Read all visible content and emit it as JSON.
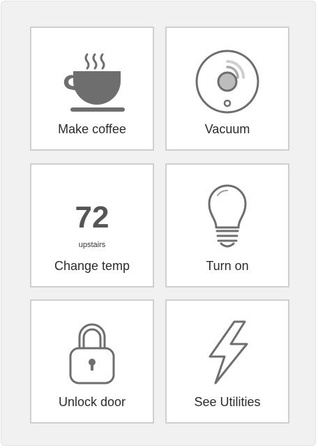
{
  "tiles": [
    {
      "label": "Make coffee",
      "icon": "coffee-cup-icon"
    },
    {
      "label": "Vacuum",
      "icon": "robot-vacuum-icon"
    },
    {
      "label": "Change temp",
      "icon": "thermostat-readout",
      "value": "72",
      "sublabel": "upstairs"
    },
    {
      "label": "Turn on",
      "icon": "light-bulb-icon"
    },
    {
      "label": "Unlock door",
      "icon": "padlock-icon"
    },
    {
      "label": "See Utilities",
      "icon": "lightning-bolt-icon"
    }
  ],
  "colors": {
    "icon_stroke": "#6e6e6e",
    "tile_border": "#cfcfcf",
    "panel_background": "#f1f1f1",
    "label_text": "#2b2b2b"
  }
}
